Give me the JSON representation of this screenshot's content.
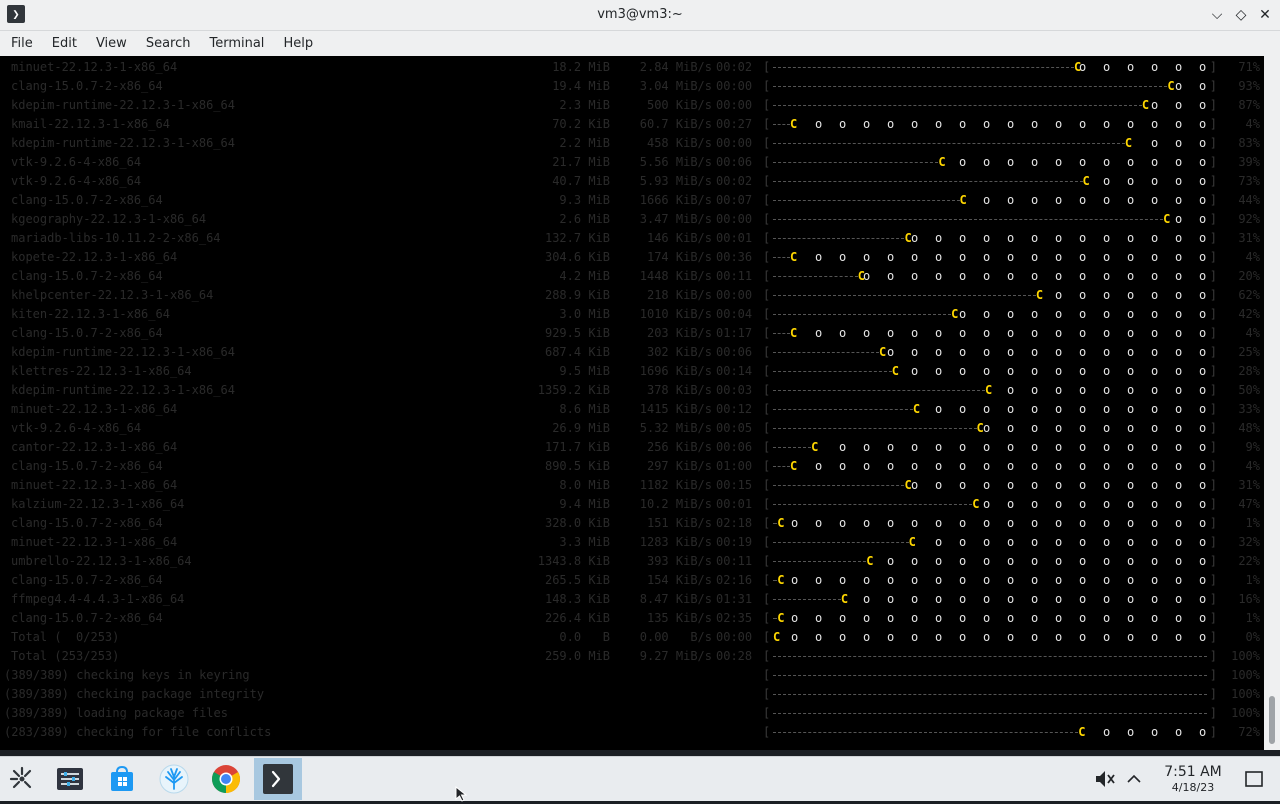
{
  "window": {
    "title": "vm3@vm3:~",
    "app_icon_glyph": "❯",
    "minimize_glyph": "⌵",
    "maximize_glyph": "◇",
    "close_glyph": "✕"
  },
  "menu": [
    "File",
    "Edit",
    "View",
    "Search",
    "Terminal",
    "Help"
  ],
  "terminal": {
    "bg": "#000000",
    "pacman_glyph": "C",
    "dot_glyph": "o",
    "bracket_open": "[",
    "bracket_close": "]",
    "rows": [
      {
        "name": "minuet-22.12.3-1-x86_64",
        "size": "18.2 MiB",
        "rate": "2.84 MiB/s",
        "time": "00:02",
        "pct": "71%",
        "progress": 0.71
      },
      {
        "name": "clang-15.0.7-2-x86_64",
        "size": "19.4 MiB",
        "rate": "3.04 MiB/s",
        "time": "00:00",
        "pct": "93%",
        "progress": 0.93
      },
      {
        "name": "kdepim-runtime-22.12.3-1-x86_64",
        "size": "2.3 MiB",
        "rate": "500 KiB/s",
        "time": "00:00",
        "pct": "87%",
        "progress": 0.87
      },
      {
        "name": "kmail-22.12.3-1-x86_64",
        "size": "70.2 KiB",
        "rate": "60.7 KiB/s",
        "time": "00:27",
        "pct": "4%",
        "progress": 0.04
      },
      {
        "name": "kdepim-runtime-22.12.3-1-x86_64",
        "size": "2.2 MiB",
        "rate": "458 KiB/s",
        "time": "00:00",
        "pct": "83%",
        "progress": 0.83
      },
      {
        "name": "vtk-9.2.6-4-x86_64",
        "size": "21.7 MiB",
        "rate": "5.56 MiB/s",
        "time": "00:06",
        "pct": "39%",
        "progress": 0.39
      },
      {
        "name": "vtk-9.2.6-4-x86_64",
        "size": "40.7 MiB",
        "rate": "5.93 MiB/s",
        "time": "00:02",
        "pct": "73%",
        "progress": 0.73
      },
      {
        "name": "clang-15.0.7-2-x86_64",
        "size": "9.3 MiB",
        "rate": "1666 KiB/s",
        "time": "00:07",
        "pct": "44%",
        "progress": 0.44
      },
      {
        "name": "kgeography-22.12.3-1-x86_64",
        "size": "2.6 MiB",
        "rate": "3.47 MiB/s",
        "time": "00:00",
        "pct": "92%",
        "progress": 0.92
      },
      {
        "name": "mariadb-libs-10.11.2-2-x86_64",
        "size": "132.7 KiB",
        "rate": "146 KiB/s",
        "time": "00:01",
        "pct": "31%",
        "progress": 0.31
      },
      {
        "name": "kopete-22.12.3-1-x86_64",
        "size": "304.6 KiB",
        "rate": "174 KiB/s",
        "time": "00:36",
        "pct": "4%",
        "progress": 0.04
      },
      {
        "name": "clang-15.0.7-2-x86_64",
        "size": "4.2 MiB",
        "rate": "1448 KiB/s",
        "time": "00:11",
        "pct": "20%",
        "progress": 0.2
      },
      {
        "name": "khelpcenter-22.12.3-1-x86_64",
        "size": "288.9 KiB",
        "rate": "218 KiB/s",
        "time": "00:00",
        "pct": "62%",
        "progress": 0.62
      },
      {
        "name": "kiten-22.12.3-1-x86_64",
        "size": "3.0 MiB",
        "rate": "1010 KiB/s",
        "time": "00:04",
        "pct": "42%",
        "progress": 0.42
      },
      {
        "name": "clang-15.0.7-2-x86_64",
        "size": "929.5 KiB",
        "rate": "203 KiB/s",
        "time": "01:17",
        "pct": "4%",
        "progress": 0.04
      },
      {
        "name": "kdepim-runtime-22.12.3-1-x86_64",
        "size": "687.4 KiB",
        "rate": "302 KiB/s",
        "time": "00:06",
        "pct": "25%",
        "progress": 0.25
      },
      {
        "name": "klettres-22.12.3-1-x86_64",
        "size": "9.5 MiB",
        "rate": "1696 KiB/s",
        "time": "00:14",
        "pct": "28%",
        "progress": 0.28
      },
      {
        "name": "kdepim-runtime-22.12.3-1-x86_64",
        "size": "1359.2 KiB",
        "rate": "378 KiB/s",
        "time": "00:03",
        "pct": "50%",
        "progress": 0.5
      },
      {
        "name": "minuet-22.12.3-1-x86_64",
        "size": "8.6 MiB",
        "rate": "1415 KiB/s",
        "time": "00:12",
        "pct": "33%",
        "progress": 0.33
      },
      {
        "name": "vtk-9.2.6-4-x86_64",
        "size": "26.9 MiB",
        "rate": "5.32 MiB/s",
        "time": "00:05",
        "pct": "48%",
        "progress": 0.48
      },
      {
        "name": "cantor-22.12.3-1-x86_64",
        "size": "171.7 KiB",
        "rate": "256 KiB/s",
        "time": "00:06",
        "pct": "9%",
        "progress": 0.09
      },
      {
        "name": "clang-15.0.7-2-x86_64",
        "size": "890.5 KiB",
        "rate": "297 KiB/s",
        "time": "01:00",
        "pct": "4%",
        "progress": 0.04
      },
      {
        "name": "minuet-22.12.3-1-x86_64",
        "size": "8.0 MiB",
        "rate": "1182 KiB/s",
        "time": "00:15",
        "pct": "31%",
        "progress": 0.31
      },
      {
        "name": "kalzium-22.12.3-1-x86_64",
        "size": "9.4 MiB",
        "rate": "10.2 MiB/s",
        "time": "00:01",
        "pct": "47%",
        "progress": 0.47
      },
      {
        "name": "clang-15.0.7-2-x86_64",
        "size": "328.0 KiB",
        "rate": "151 KiB/s",
        "time": "02:18",
        "pct": "1%",
        "progress": 0.01
      },
      {
        "name": "minuet-22.12.3-1-x86_64",
        "size": "3.3 MiB",
        "rate": "1283 KiB/s",
        "time": "00:19",
        "pct": "32%",
        "progress": 0.32
      },
      {
        "name": "umbrello-22.12.3-1-x86_64",
        "size": "1343.8 KiB",
        "rate": "393 KiB/s",
        "time": "00:11",
        "pct": "22%",
        "progress": 0.22
      },
      {
        "name": "clang-15.0.7-2-x86_64",
        "size": "265.5 KiB",
        "rate": "154 KiB/s",
        "time": "02:16",
        "pct": "1%",
        "progress": 0.01
      },
      {
        "name": "ffmpeg4.4-4.4.3-1-x86_64",
        "size": "148.3 KiB",
        "rate": "8.47 KiB/s",
        "time": "01:31",
        "pct": "16%",
        "progress": 0.16
      },
      {
        "name": "clang-15.0.7-2-x86_64",
        "size": "226.4 KiB",
        "rate": "135 KiB/s",
        "time": "02:35",
        "pct": "1%",
        "progress": 0.01
      },
      {
        "name": "Total (  0/253)",
        "size": "0.0   B",
        "rate": "0.00   B/s",
        "time": "00:00",
        "pct": "0%",
        "progress": 0.0
      },
      {
        "name": "Total (253/253)",
        "size": "259.0 MiB",
        "rate": "9.27 MiB/s",
        "time": "00:28",
        "pct": "100%",
        "progress": 1.0
      }
    ],
    "steps": [
      {
        "text": "(389/389) checking keys in keyring",
        "pct": "100%",
        "progress": 1.0
      },
      {
        "text": "(389/389) checking package integrity",
        "pct": "100%",
        "progress": 1.0
      },
      {
        "text": "(389/389) loading package files",
        "pct": "100%",
        "progress": 1.0
      },
      {
        "text": "(283/389) checking for file conflicts",
        "pct": "72%",
        "progress": 0.72
      }
    ]
  },
  "taskbar": {
    "clock_time": "7:51 AM",
    "clock_date": "4/18/23"
  }
}
